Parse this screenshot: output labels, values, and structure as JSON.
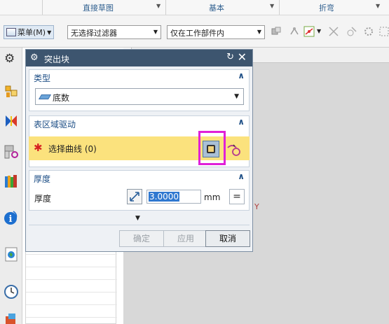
{
  "ribbon": {
    "groups": [
      "直接草图",
      "基本",
      "折弯"
    ]
  },
  "toolbar": {
    "menu_label": "菜单(M)",
    "filter_value": "无选择过滤器",
    "scope_value": "仅在工作部件内"
  },
  "dialog": {
    "title": "突出块",
    "type_section": {
      "heading": "类型",
      "selected": "底数"
    },
    "surface_section": {
      "heading": "表区域驱动",
      "select_label": "选择曲线 (0)"
    },
    "thickness_section": {
      "heading": "厚度",
      "label": "厚度",
      "value": "3.0000",
      "unit": "mm",
      "eq": "="
    },
    "buttons": {
      "ok": "确定",
      "apply": "应用",
      "cancel": "取消"
    }
  },
  "graphics": {
    "axis_label": "Y"
  },
  "colors": {
    "title_bar": "#3d556f",
    "section_heading": "#1e4f86",
    "selection_highlight": "#fbe27d",
    "callout_border": "#e020d8",
    "required_star": "#d62020"
  },
  "icons": [
    "menu-icon",
    "gear-icon",
    "reset-icon",
    "close-icon",
    "curve-select-icon",
    "sketch-section-icon",
    "thickness-reverse-icon"
  ]
}
